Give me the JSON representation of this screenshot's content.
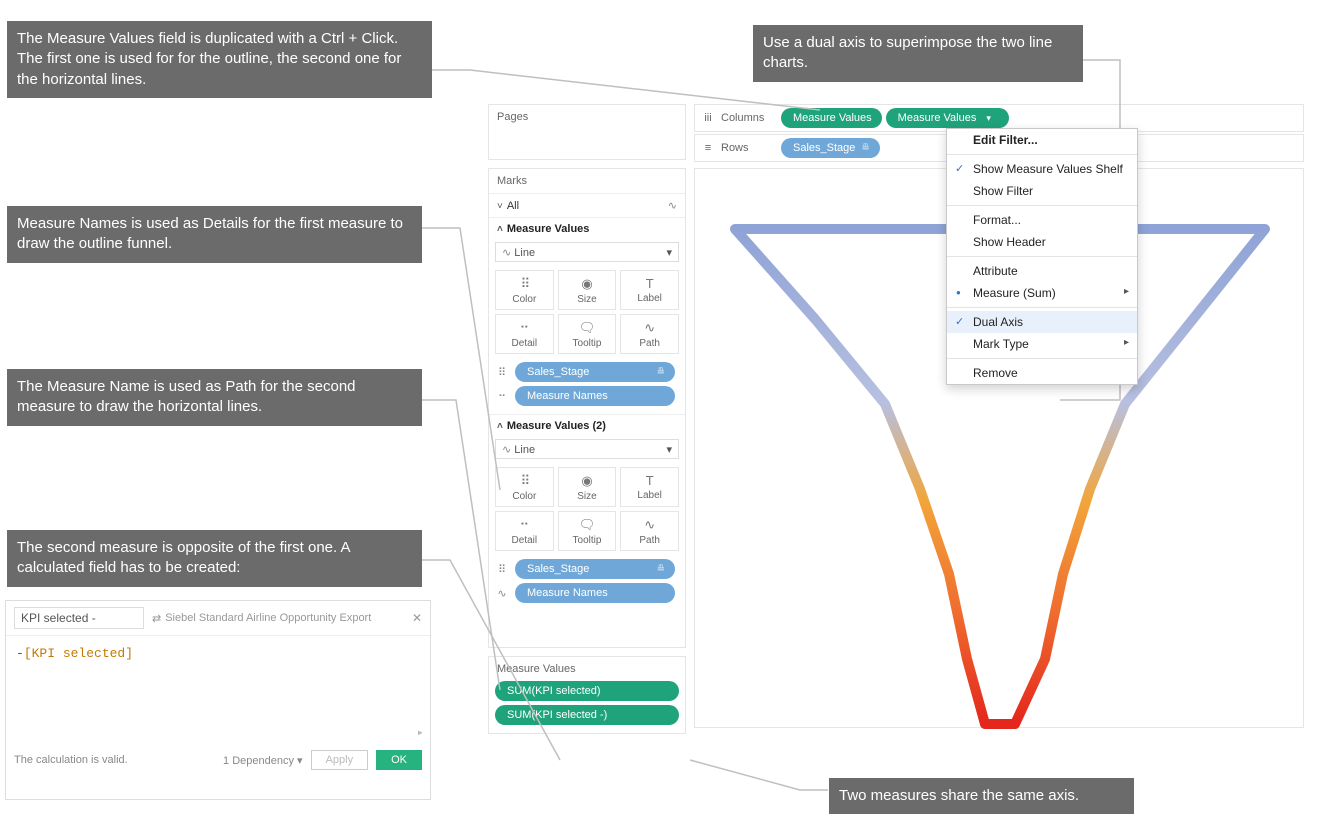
{
  "callouts": {
    "c1": "The Measure Values field is duplicated with a Ctrl + Click. The first one is used for for the outline, the second one for the horizontal lines.",
    "c2": "Use a dual axis to superimpose the two line charts.",
    "c3": "Measure Names is used as Details for the first  measure to draw the outline funnel.",
    "c4": "The Measure Name is used as Path for the second measure to draw the horizontal lines.",
    "c5": "The second measure is opposite of the first one. A calculated field has to be created:",
    "c6": "Two measures share the same axis."
  },
  "shelves": {
    "pages_label": "Pages",
    "columns_label": "Columns",
    "rows_label": "Rows",
    "columns_pill1": "Measure Values",
    "columns_pill2": "Measure Values",
    "rows_pill": "Sales_Stage"
  },
  "marks": {
    "title": "Marks",
    "all": "All",
    "card1_title": "Measure Values",
    "card2_title": "Measure Values (2)",
    "line": "Line",
    "cells": {
      "color": "Color",
      "size": "Size",
      "label": "Label",
      "detail": "Detail",
      "tooltip": "Tooltip",
      "path": "Path"
    },
    "pill_stage": "Sales_Stage",
    "pill_mnames": "Measure Names"
  },
  "mv_shelf": {
    "title": "Measure Values",
    "p1": "SUM(KPI selected)",
    "p2": "SUM(KPI selected -)"
  },
  "ctx": {
    "edit": "Edit Filter...",
    "showShelf": "Show Measure Values Shelf",
    "showFilter": "Show Filter",
    "format": "Format...",
    "showHeader": "Show Header",
    "attribute": "Attribute",
    "measure": "Measure (Sum)",
    "dualAxis": "Dual Axis",
    "markType": "Mark Type",
    "remove": "Remove"
  },
  "calc": {
    "name": "KPI selected -",
    "datasource": "Siebel Standard Airline Opportunity Export",
    "formula": "[KPI selected]",
    "valid": "The calculation is valid.",
    "dep": "1 Dependency",
    "apply": "Apply",
    "ok": "OK"
  }
}
